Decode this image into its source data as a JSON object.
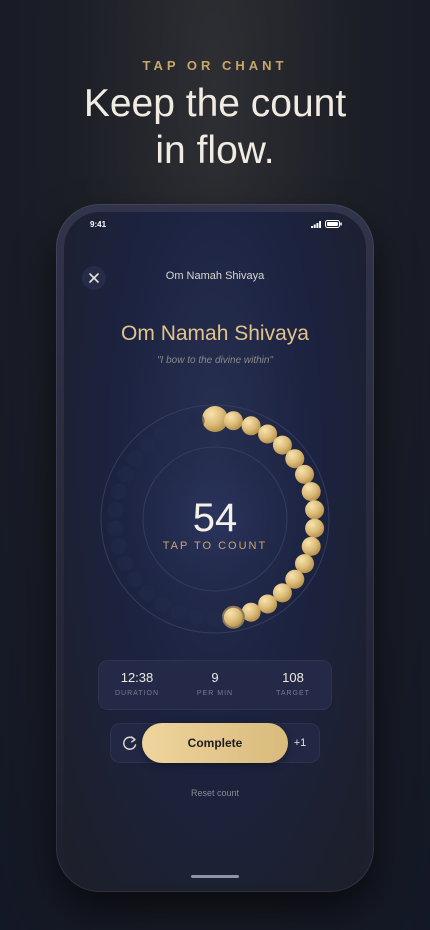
{
  "promo": {
    "kicker": "TAP OR CHANT",
    "headline_line1": "Keep the count",
    "headline_line2": "in flow."
  },
  "status_bar": {
    "time": "9:41",
    "icons": [
      "signal-icon",
      "battery-icon"
    ]
  },
  "nav": {
    "title": "Om Namah Shivaya",
    "close_icon": "close-icon"
  },
  "mantra": {
    "title": "Om Namah Shivaya",
    "translation": "\"I bow to the divine within\""
  },
  "counter": {
    "count": "54",
    "label": "TAP TO COUNT",
    "target": 108,
    "progress_fraction": 0.5
  },
  "stats": [
    {
      "value": "12:38",
      "label": "DURATION"
    },
    {
      "value": "9",
      "label": "PER MIN"
    },
    {
      "value": "108",
      "label": "TARGET"
    }
  ],
  "actions": {
    "reset_icon": "reset-icon",
    "complete_label": "Complete",
    "increment_label": "+1",
    "reset_link": "Reset count"
  },
  "colors": {
    "accent_gold": "#c9a66b",
    "bead_gold": "#e3c787",
    "background": "#1c2341"
  }
}
